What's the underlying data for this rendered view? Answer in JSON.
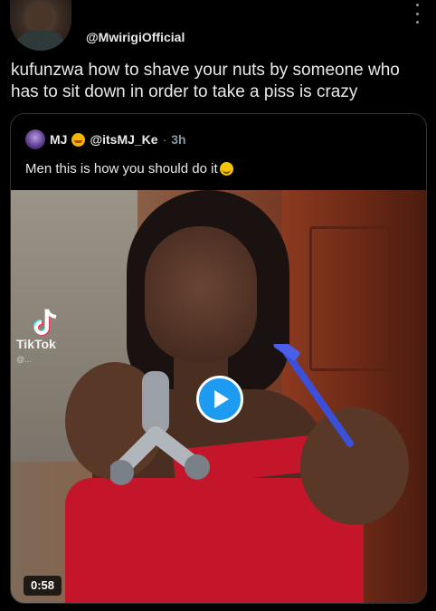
{
  "post": {
    "handle": "@MwirigiOfficial",
    "text": "kufunzwa how to shave your nuts by someone who has to sit down in order to take a piss is crazy"
  },
  "quote": {
    "name": "MJ",
    "handle": "@itsMJ_Ke",
    "separator": "·",
    "time": "3h",
    "text": "Men this is how you should do it",
    "video": {
      "watermark": "TikTok",
      "watermark_user": "@...",
      "duration": "0:58"
    }
  },
  "colors": {
    "background": "#000000",
    "accent": "#1d9bf0",
    "border": "#2f3336",
    "text": "#e7e9ea",
    "muted": "#8b98a5"
  },
  "icons": [
    "more-icon",
    "play-icon",
    "tiktok-logo-icon"
  ]
}
